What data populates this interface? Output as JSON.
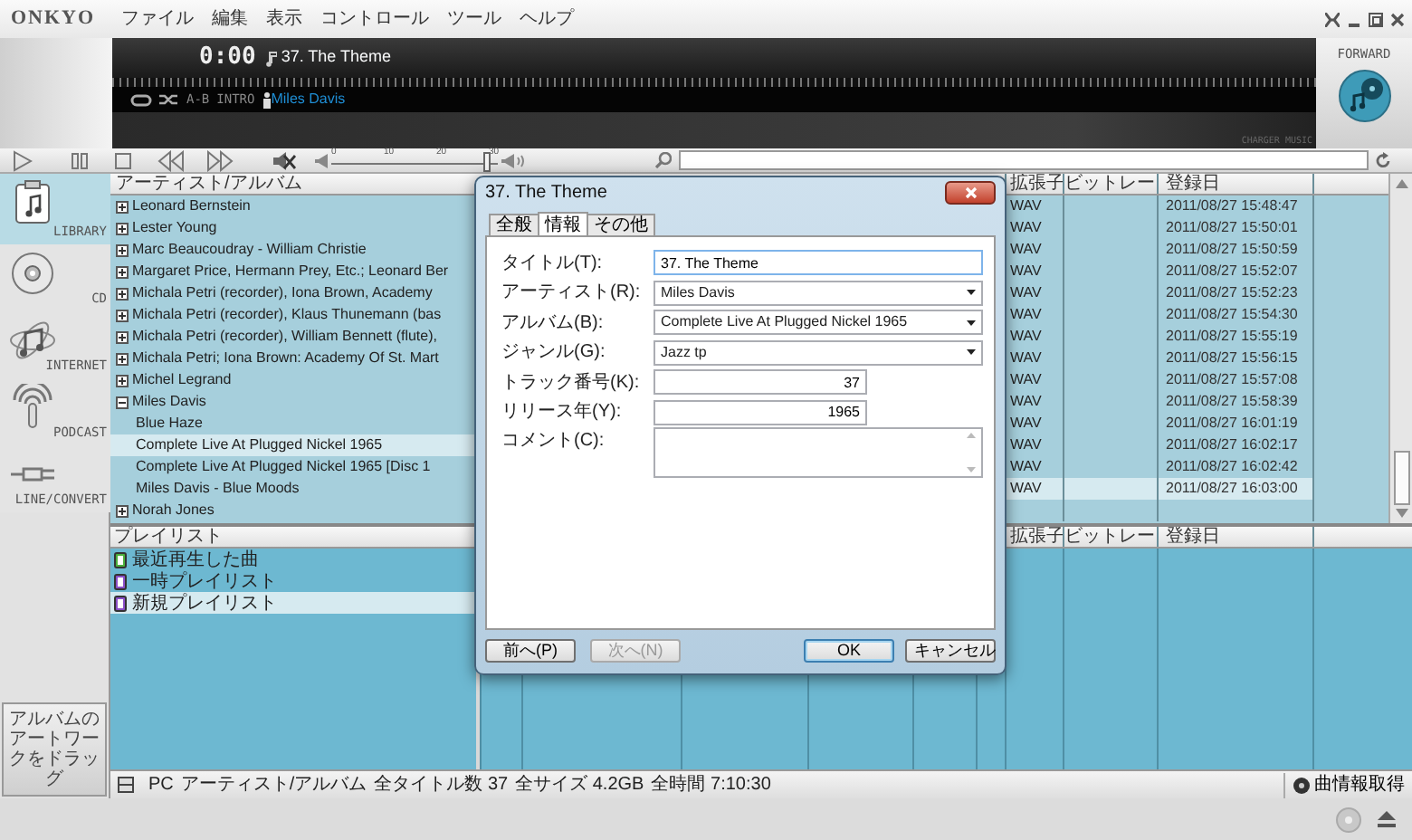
{
  "menu_bar": {
    "logo": "ONKYO",
    "items": [
      "ファイル",
      "編集",
      "表示",
      "コントロール",
      "ツール",
      "ヘルプ"
    ]
  },
  "display": {
    "time": "0:00",
    "title": "37. The Theme",
    "modes": [
      "A-B",
      "INTRO"
    ],
    "artist": "Miles Davis",
    "brand": "CHARGER MUSIC"
  },
  "brand_logo": {
    "label": "FORWARD"
  },
  "toolbar": {
    "volume": {
      "ticks": [
        "0",
        "10",
        "20",
        "30"
      ],
      "level": 0.93
    }
  },
  "sidebar": {
    "items": [
      {
        "label": "LIBRARY",
        "kind": "library",
        "selected": true
      },
      {
        "label": "CD",
        "kind": "cd",
        "selected": false
      },
      {
        "label": "INTERNET",
        "kind": "internet",
        "selected": false
      },
      {
        "label": "PODCAST",
        "kind": "podcast",
        "selected": false
      },
      {
        "label": "LINE/CONVERT",
        "kind": "line",
        "selected": false
      }
    ],
    "artwork_drop": "アルバムのアートワークをドラッグ"
  },
  "tree": {
    "header": "アーティスト/アルバム",
    "items": [
      {
        "label": "Leonard Bernstein",
        "expanded": false,
        "selected": false
      },
      {
        "label": "Lester Young",
        "expanded": false,
        "selected": false
      },
      {
        "label": "Marc Beaucoudray - William Christie",
        "expanded": false,
        "selected": false
      },
      {
        "label": "Margaret Price, Hermann Prey, Etc.; Leonard Ber",
        "expanded": false,
        "selected": false
      },
      {
        "label": "Michala Petri (recorder), Iona Brown, Academy",
        "expanded": false,
        "selected": false
      },
      {
        "label": "Michala Petri (recorder), Klaus Thunemann (bas",
        "expanded": false,
        "selected": false
      },
      {
        "label": "Michala Petri (recorder), William Bennett (flute),",
        "expanded": false,
        "selected": false
      },
      {
        "label": "Michala Petri; Iona Brown: Academy Of St. Mart",
        "expanded": false,
        "selected": false
      },
      {
        "label": "Michel Legrand",
        "expanded": false,
        "selected": false
      },
      {
        "label": "Miles Davis",
        "expanded": true,
        "selected": false,
        "children": [
          {
            "label": "Blue Haze",
            "selected": false
          },
          {
            "label": "Complete Live At Plugged Nickel 1965",
            "selected": true
          },
          {
            "label": "Complete Live At Plugged Nickel 1965 [Disc 1",
            "selected": false
          },
          {
            "label": "Miles Davis - Blue Moods",
            "selected": false
          }
        ]
      },
      {
        "label": "Norah Jones",
        "expanded": false,
        "selected": false
      }
    ]
  },
  "track_table": {
    "columns": [
      "拡張子",
      "ビットレー",
      "登録日"
    ],
    "rows": [
      {
        "ext": "WAV",
        "date": "2011/08/27 15:48:47",
        "selected": false
      },
      {
        "ext": "WAV",
        "date": "2011/08/27 15:50:01",
        "selected": false
      },
      {
        "ext": "WAV",
        "date": "2011/08/27 15:50:59",
        "selected": false
      },
      {
        "ext": "WAV",
        "date": "2011/08/27 15:52:07",
        "selected": false
      },
      {
        "ext": "WAV",
        "date": "2011/08/27 15:52:23",
        "selected": false
      },
      {
        "ext": "WAV",
        "date": "2011/08/27 15:54:30",
        "selected": false
      },
      {
        "ext": "WAV",
        "date": "2011/08/27 15:55:19",
        "selected": false
      },
      {
        "ext": "WAV",
        "date": "2011/08/27 15:56:15",
        "selected": false
      },
      {
        "ext": "WAV",
        "date": "2011/08/27 15:57:08",
        "selected": false
      },
      {
        "ext": "WAV",
        "date": "2011/08/27 15:58:39",
        "selected": false
      },
      {
        "ext": "WAV",
        "date": "2011/08/27 16:01:19",
        "selected": false
      },
      {
        "ext": "WAV",
        "date": "2011/08/27 16:02:17",
        "selected": false
      },
      {
        "ext": "WAV",
        "date": "2011/08/27 16:02:42",
        "selected": false
      },
      {
        "ext": "WAV",
        "date": "2011/08/27 16:03:00",
        "selected": true
      }
    ]
  },
  "playlists": {
    "header": "プレイリスト",
    "items": [
      {
        "label": "最近再生した曲",
        "color": "#4caf3c",
        "selected": false
      },
      {
        "label": "一時プレイリスト",
        "color": "#8a4fc8",
        "selected": false
      },
      {
        "label": "新規プレイリスト",
        "color": "#8a4fc8",
        "selected": true
      }
    ]
  },
  "playlist_table": {
    "columns": [
      "拡張子",
      "ビットレー",
      "登録日"
    ]
  },
  "status_bar": {
    "items": [
      "PC",
      "アーティスト/アルバム",
      "全タイトル数 37",
      "全サイズ 4.2GB",
      "全時間 7:10:30"
    ],
    "button": "曲情報取得"
  },
  "dialog": {
    "title": "37. The Theme",
    "tabs": [
      {
        "label": "全般",
        "selected": false
      },
      {
        "label": "情報",
        "selected": true
      },
      {
        "label": "その他",
        "selected": false
      }
    ],
    "fields": [
      {
        "label": "タイトル(T):",
        "kind": "text",
        "value": "37. The Theme"
      },
      {
        "label": "アーティスト(R):",
        "kind": "combo",
        "value": "Miles Davis"
      },
      {
        "label": "アルバム(B):",
        "kind": "combo",
        "value": "Complete Live At Plugged Nickel 1965"
      },
      {
        "label": "ジャンル(G):",
        "kind": "combo",
        "value": "Jazz tp"
      },
      {
        "label": "トラック番号(K):",
        "kind": "number",
        "value": "37"
      },
      {
        "label": "リリース年(Y):",
        "kind": "number",
        "value": "1965"
      },
      {
        "label": "コメント(C):",
        "kind": "memo"
      }
    ],
    "buttons": [
      {
        "label": "前へ(P)",
        "disabled": false,
        "default": false
      },
      {
        "label": "次へ(N)",
        "disabled": true,
        "default": false
      },
      {
        "label": "OK",
        "disabled": false,
        "default": true
      },
      {
        "label": "キャンセル",
        "disabled": false,
        "default": false
      }
    ]
  }
}
